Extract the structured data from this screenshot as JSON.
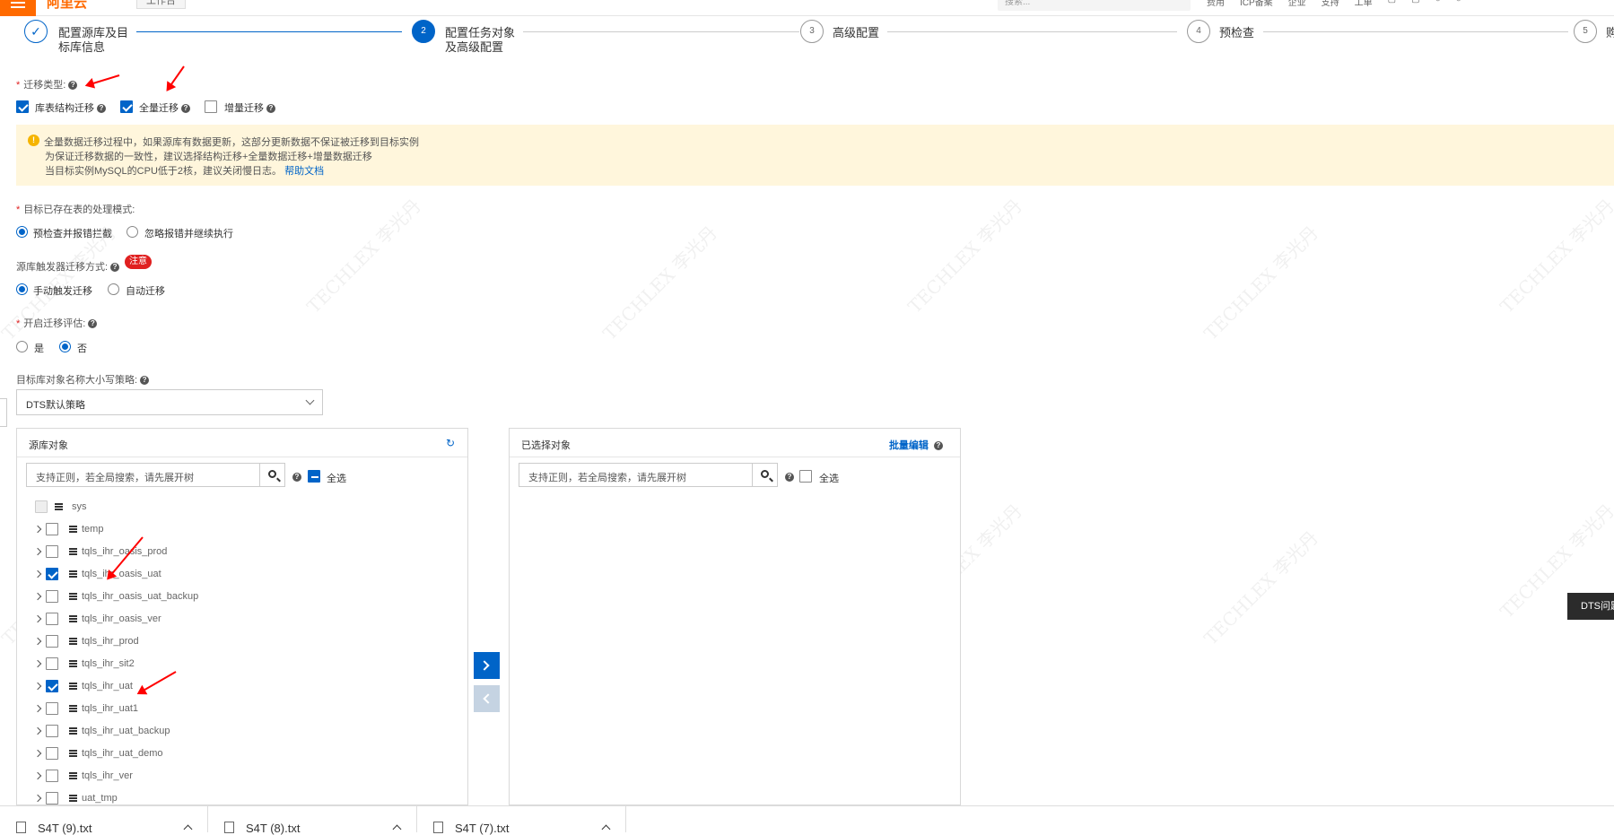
{
  "topbar": {
    "logo": "阿里云",
    "workspace": "工作台",
    "search_placeholder": "搜索...",
    "icons": [
      "费用",
      "ICP备案",
      "企业",
      "支持",
      "工单",
      "message-icon",
      "cart-icon",
      "help-icon",
      "user-icon"
    ]
  },
  "steps": [
    {
      "num": "✓",
      "label_line1": "配置源库及目",
      "label_line2": "标库信息"
    },
    {
      "num": "2",
      "label_line1": "配置任务对象",
      "label_line2": "及高级配置"
    },
    {
      "num": "3",
      "label_line1": "高级配置",
      "label_line2": ""
    },
    {
      "num": "4",
      "label_line1": "预检查",
      "label_line2": ""
    },
    {
      "num": "5",
      "label_line1": "购",
      "label_line2": ""
    }
  ],
  "migration_type": {
    "label": "迁移类型:",
    "options": [
      {
        "label": "库表结构迁移",
        "checked": true
      },
      {
        "label": "全量迁移",
        "checked": true
      },
      {
        "label": "增量迁移",
        "checked": false
      }
    ]
  },
  "alert": {
    "line1": "全量数据迁移过程中，如果源库有数据更新，这部分更新数据不保证被迁移到目标实例",
    "line2": "为保证迁移数据的一致性，建议选择结构迁移+全量数据迁移+增量数据迁移",
    "line3": "当目标实例MySQL的CPU低于2核，建议关闭慢日志。",
    "link": "帮助文档"
  },
  "existing_table_mode": {
    "label": "目标已存在表的处理模式:",
    "options": [
      {
        "label": "预检查并报错拦截",
        "selected": true
      },
      {
        "label": "忽略报错并继续执行",
        "selected": false
      }
    ]
  },
  "trigger_mode": {
    "label": "源库触发器迁移方式:",
    "badge": "注意",
    "options": [
      {
        "label": "手动触发迁移",
        "selected": true
      },
      {
        "label": "自动迁移",
        "selected": false
      }
    ]
  },
  "assessment": {
    "label": "开启迁移评估:",
    "options": [
      {
        "label": "是",
        "selected": false
      },
      {
        "label": "否",
        "selected": true
      }
    ]
  },
  "case_policy": {
    "label": "目标库对象名称大小写策略:",
    "value": "DTS默认策略"
  },
  "source_panel": {
    "title": "源库对象",
    "search_placeholder": "支持正则，若全局搜索，请先展开树",
    "select_all": "全选",
    "items": [
      {
        "name": "sys",
        "checked": false,
        "disabled": true
      },
      {
        "name": "temp",
        "checked": false
      },
      {
        "name": "tqls_ihr_oasis_prod",
        "checked": false
      },
      {
        "name": "tqls_ihr_oasis_uat",
        "checked": true
      },
      {
        "name": "tqls_ihr_oasis_uat_backup",
        "checked": false
      },
      {
        "name": "tqls_ihr_oasis_ver",
        "checked": false
      },
      {
        "name": "tqls_ihr_prod",
        "checked": false
      },
      {
        "name": "tqls_ihr_sit2",
        "checked": false
      },
      {
        "name": "tqls_ihr_uat",
        "checked": true
      },
      {
        "name": "tqls_ihr_uat1",
        "checked": false
      },
      {
        "name": "tqls_ihr_uat_backup",
        "checked": false
      },
      {
        "name": "tqls_ihr_uat_demo",
        "checked": false
      },
      {
        "name": "tqls_ihr_ver",
        "checked": false
      },
      {
        "name": "uat_tmp",
        "checked": false
      }
    ]
  },
  "selected_panel": {
    "title": "已选择对象",
    "batch_edit": "批量编辑",
    "search_placeholder": "支持正则，若全局搜索，请先展开树",
    "select_all": "全选"
  },
  "tooltip": "DTS问题",
  "downloads": [
    "S4T (9).txt",
    "S4T (8).txt",
    "S4T (7).txt"
  ],
  "colors": {
    "primary": "#0064c8",
    "brand": "#ff6a00",
    "alert_bg": "#fff6dc",
    "annotation": "#ff0000"
  }
}
